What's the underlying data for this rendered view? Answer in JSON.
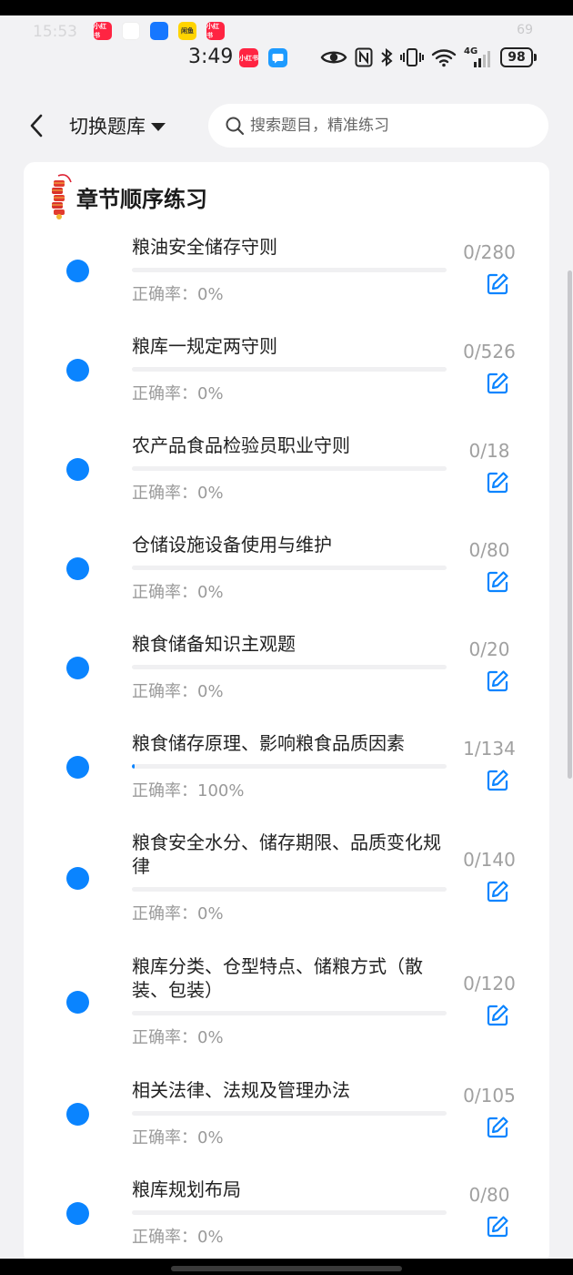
{
  "status_bar": {
    "ghost_time": "15:53",
    "ghost_battery": "69",
    "time": "3:49",
    "battery": "98",
    "network": "4G",
    "mini_apps": [
      {
        "name": "xiaohongshu-icon",
        "label": "小红书",
        "color": "#ff2442"
      },
      {
        "name": "sail-app-icon",
        "label": "",
        "color": "#ffffff"
      },
      {
        "name": "blue-app-icon",
        "label": "",
        "color": "#1677ff"
      },
      {
        "name": "yellow-app-icon",
        "label": "闲鱼",
        "color": "#ffd400"
      },
      {
        "name": "xiaohongshu-icon-2",
        "label": "小红书",
        "color": "#ff2442"
      }
    ],
    "apps": [
      {
        "name": "xiaohongshu-icon",
        "label": "小红书",
        "color": "#ff2442"
      },
      {
        "name": "message-bubble-icon",
        "label": "",
        "color": "#1e9bff"
      }
    ]
  },
  "nav": {
    "switch_bank": "切换题库",
    "search_placeholder": "搜索题目，精准练习"
  },
  "card": {
    "title": "章节顺序练习"
  },
  "accent_color": "#0a84ff",
  "chapters": [
    {
      "title": "粮油安全储存守则",
      "accuracy": "正确率：0%",
      "count": "0/280",
      "progress": 0
    },
    {
      "title": "粮库一规定两守则",
      "accuracy": "正确率：0%",
      "count": "0/526",
      "progress": 0
    },
    {
      "title": "农产品食品检验员职业守则",
      "accuracy": "正确率：0%",
      "count": "0/18",
      "progress": 0
    },
    {
      "title": "仓储设施设备使用与维护",
      "accuracy": "正确率：0%",
      "count": "0/80",
      "progress": 0
    },
    {
      "title": "粮食储备知识主观题",
      "accuracy": "正确率：0%",
      "count": "0/20",
      "progress": 0
    },
    {
      "title": "粮食储存原理、影响粮食品质因素",
      "accuracy": "正确率：100%",
      "count": "1/134",
      "progress": 0.0075
    },
    {
      "title": "粮食安全水分、储存期限、品质变化规律",
      "accuracy": "正确率：0%",
      "count": "0/140",
      "progress": 0
    },
    {
      "title": "粮库分类、仓型特点、储粮方式（散装、包装）",
      "accuracy": "正确率：0%",
      "count": "0/120",
      "progress": 0
    },
    {
      "title": "相关法律、法规及管理办法",
      "accuracy": "正确率：0%",
      "count": "0/105",
      "progress": 0
    },
    {
      "title": "粮库规划布局",
      "accuracy": "正确率：0%",
      "count": "0/80",
      "progress": 0
    }
  ]
}
